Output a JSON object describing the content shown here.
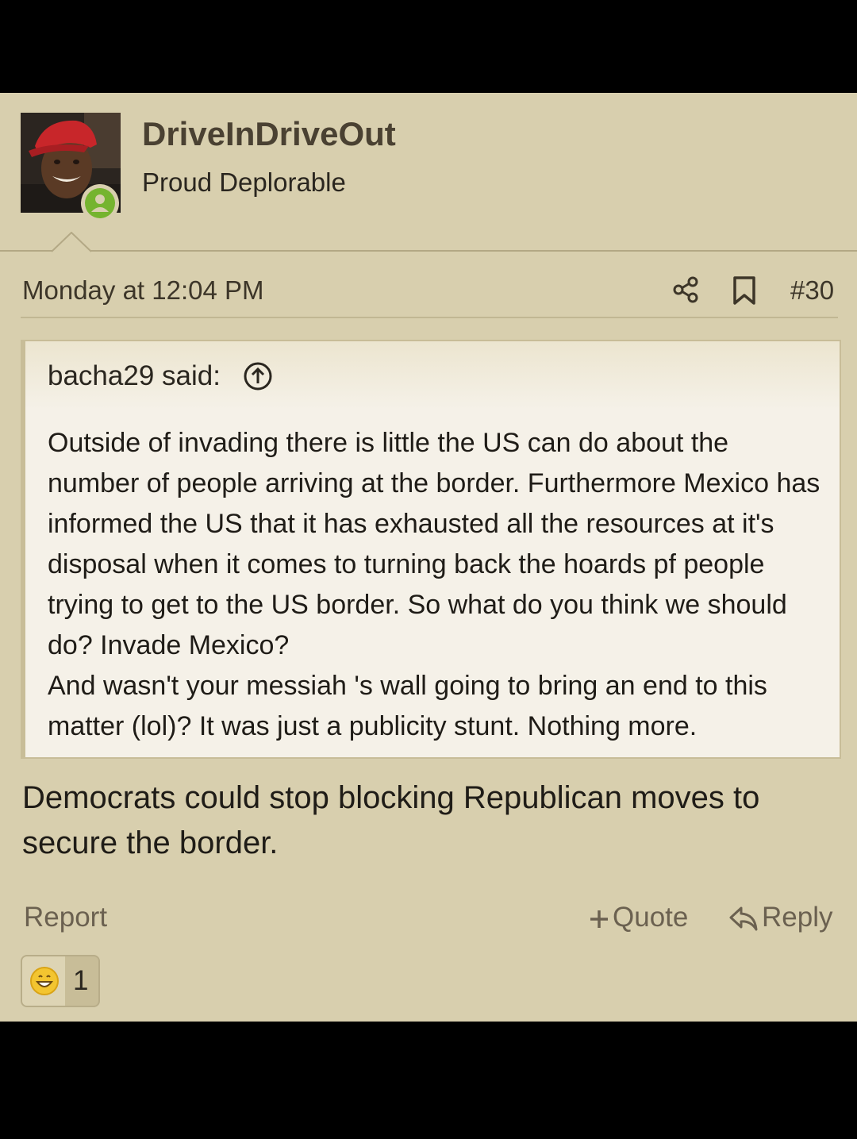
{
  "user": {
    "name": "DriveInDriveOut",
    "title": "Proud Deplorable"
  },
  "meta": {
    "date": "Monday at 12:04 PM",
    "post_number": "#30",
    "share_icon": "share-icon",
    "bookmark_icon": "bookmark-icon"
  },
  "quote": {
    "author": "bacha29 said:",
    "jump_icon": "arrow-up-circle-icon",
    "paragraphs": [
      "Outside of invading there is little the US can do about the number of people arriving at the border. Furthermore Mexico has informed the US that it has exhausted all the resources at it's disposal when it comes to turning back the hoards pf people trying to get to the US border. So what do you think we should do? Invade Mexico?",
      "And wasn't your messiah 's wall going to bring an end to this matter (lol)? It was just a publicity stunt. Nothing more."
    ]
  },
  "message": "Democrats could stop blocking Republican moves to secure the border.",
  "actions": {
    "report": "Report",
    "quote": "Quote",
    "reply": "Reply"
  },
  "reaction": {
    "icon": "grin-emoji-icon",
    "count": "1"
  },
  "colors": {
    "post_bg": "#d8cfae",
    "quote_bg": "#f5f1e8",
    "online": "#75b42f"
  }
}
